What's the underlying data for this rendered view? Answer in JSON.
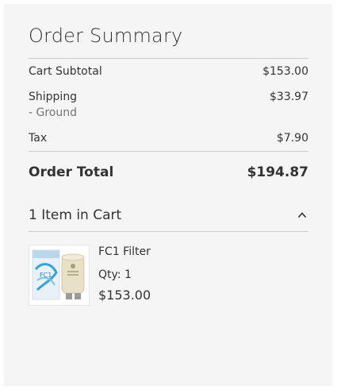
{
  "summary": {
    "title": "Order Summary",
    "subtotal_label": "Cart Subtotal",
    "subtotal_value": "$153.00",
    "shipping_label": "Shipping",
    "shipping_method": "- Ground",
    "shipping_value": "$33.97",
    "tax_label": "Tax",
    "tax_value": "$7.90",
    "total_label": "Order Total",
    "total_value": "$194.87"
  },
  "cart": {
    "items_heading": "1 Item in Cart",
    "toggle_icon": "chevron-up-icon",
    "items": [
      {
        "name": "FC1 Filter",
        "qty_label": "Qty:",
        "qty_value": "1",
        "price": "$153.00",
        "image_label": "FC1"
      }
    ]
  }
}
